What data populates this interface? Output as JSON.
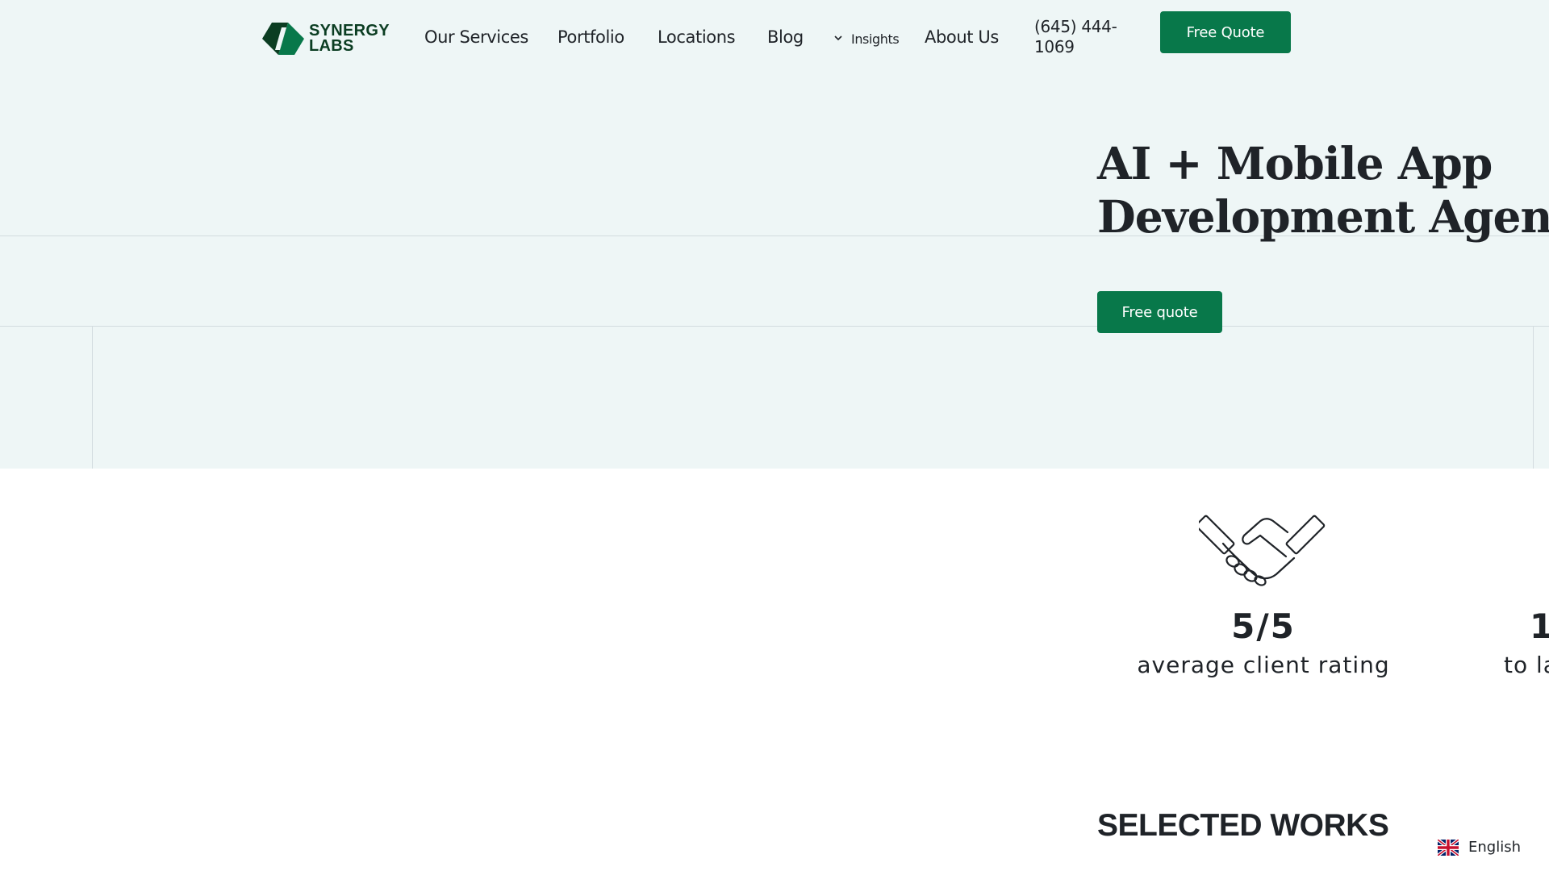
{
  "header": {
    "logo": {
      "line1": "SYNERGY",
      "line2": "LABS"
    },
    "nav": [
      {
        "label": "Our Services"
      },
      {
        "label": "Portfolio"
      },
      {
        "label": "Locations"
      },
      {
        "label": "Blog"
      },
      {
        "label": "Insights"
      },
      {
        "label": "About Us"
      }
    ],
    "phone": "(645) 444-1069",
    "cta_label": "Free Quote"
  },
  "hero": {
    "title_line1": "AI + Mobile App",
    "title_line2": "Development Agency",
    "cta_label": "Free quote"
  },
  "stats": [
    {
      "value": "5/5",
      "label": "average client rating",
      "icon": "handshake-icon"
    },
    {
      "value": "1",
      "label": "to la"
    }
  ],
  "sections": {
    "selected_works": "SELECTED WORKS"
  },
  "language": {
    "label": "English",
    "flag": "uk-flag-icon"
  },
  "colors": {
    "brand_green": "#08784a",
    "logo_green": "#0b3d22",
    "hero_bg": "#eef6f6",
    "text": "#1f2328"
  }
}
